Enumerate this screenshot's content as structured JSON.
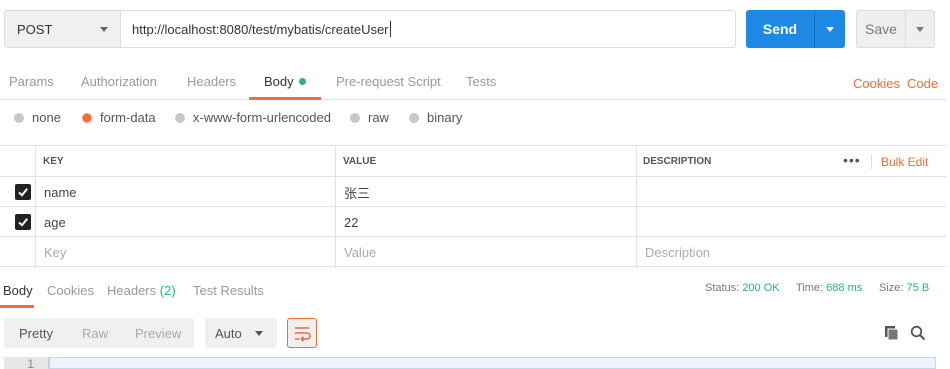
{
  "request": {
    "method": "POST",
    "url": "http://localhost:8080/test/mybatis/createUser",
    "send_label": "Send",
    "save_label": "Save"
  },
  "request_tabs": [
    {
      "label": "Params"
    },
    {
      "label": "Authorization"
    },
    {
      "label": "Headers"
    },
    {
      "label": "Body"
    },
    {
      "label": "Pre-request Script"
    },
    {
      "label": "Tests"
    }
  ],
  "request_links": {
    "cookies": "Cookies",
    "code": "Code"
  },
  "body_types": [
    {
      "label": "none",
      "selected": false
    },
    {
      "label": "form-data",
      "selected": true
    },
    {
      "label": "x-www-form-urlencoded",
      "selected": false
    },
    {
      "label": "raw",
      "selected": false
    },
    {
      "label": "binary",
      "selected": false
    }
  ],
  "table": {
    "headers": {
      "key": "KEY",
      "value": "VALUE",
      "description": "DESCRIPTION"
    },
    "bulk_edit": "Bulk Edit",
    "rows": [
      {
        "key": "name",
        "value": "张三",
        "description": "",
        "checked": true
      },
      {
        "key": "age",
        "value": "22",
        "description": "",
        "checked": true
      }
    ],
    "placeholders": {
      "key": "Key",
      "value": "Value",
      "description": "Description"
    }
  },
  "response_tabs": [
    {
      "label": "Body"
    },
    {
      "label": "Cookies"
    },
    {
      "label": "Headers",
      "count": "(2)"
    },
    {
      "label": "Test Results"
    }
  ],
  "response_status": {
    "status_label": "Status:",
    "status_value": "200 OK",
    "time_label": "Time:",
    "time_value": "688 ms",
    "size_label": "Size:",
    "size_value": "75 B"
  },
  "response_toolbar": {
    "view_modes": [
      "Pretty",
      "Raw",
      "Preview"
    ],
    "format": "Auto"
  },
  "editor": {
    "line_number": "1"
  },
  "colors": {
    "accent": "#f26b3a",
    "primary": "#1e88e5",
    "success": "#26b47f"
  }
}
